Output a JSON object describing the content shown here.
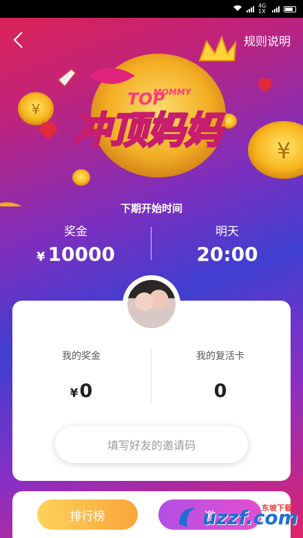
{
  "status": {
    "network": "4G 1X"
  },
  "header": {
    "rules_label": "规则说明"
  },
  "hero": {
    "logo_title": "冲顶妈妈",
    "logo_subtitle_top": "TOP",
    "logo_subtitle_mommy": "MOMMY",
    "coin_symbol": "¥"
  },
  "schedule": {
    "label": "下期开始时间",
    "prize_label": "奖金",
    "prize_currency": "¥",
    "prize_value": "10000",
    "day_label": "明天",
    "time_value": "20:00"
  },
  "card": {
    "my_prize_label": "我的奖金",
    "my_prize_currency": "¥",
    "my_prize_value": "0",
    "revive_label": "我的复活卡",
    "revive_value": "0",
    "invite_label": "填写好友的邀请码"
  },
  "bottom": {
    "rank_label": "排行榜",
    "second_label": "邀"
  },
  "watermark": {
    "text": "uzzf.com",
    "small": "东坡下载"
  }
}
